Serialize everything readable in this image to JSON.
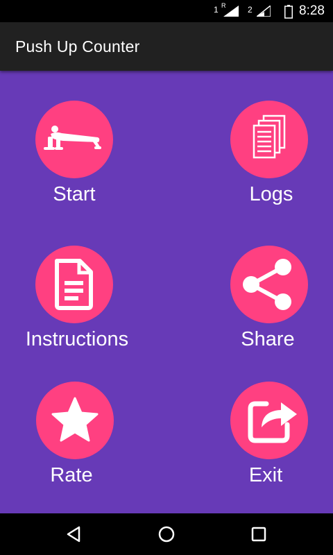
{
  "status_bar": {
    "sim1_label": "1",
    "sim1_roaming": "R",
    "sim2_label": "2",
    "time": "8:28"
  },
  "app_bar": {
    "title": "Push Up Counter"
  },
  "menu": {
    "start_label": "Start",
    "logs_label": "Logs",
    "instructions_label": "Instructions",
    "share_label": "Share",
    "rate_label": "Rate",
    "exit_label": "Exit"
  },
  "icons": {
    "start": "pushup-icon",
    "logs": "documents-icon",
    "instructions": "document-icon",
    "share": "share-icon",
    "rate": "star-icon",
    "exit": "exit-share-icon",
    "nav_back": "back-triangle-icon",
    "nav_home": "home-circle-icon",
    "nav_recents": "recents-square-icon"
  },
  "colors": {
    "background": "#673ab7",
    "app_bar": "#212121",
    "accent": "#ff4081",
    "status_bar": "#000000"
  }
}
